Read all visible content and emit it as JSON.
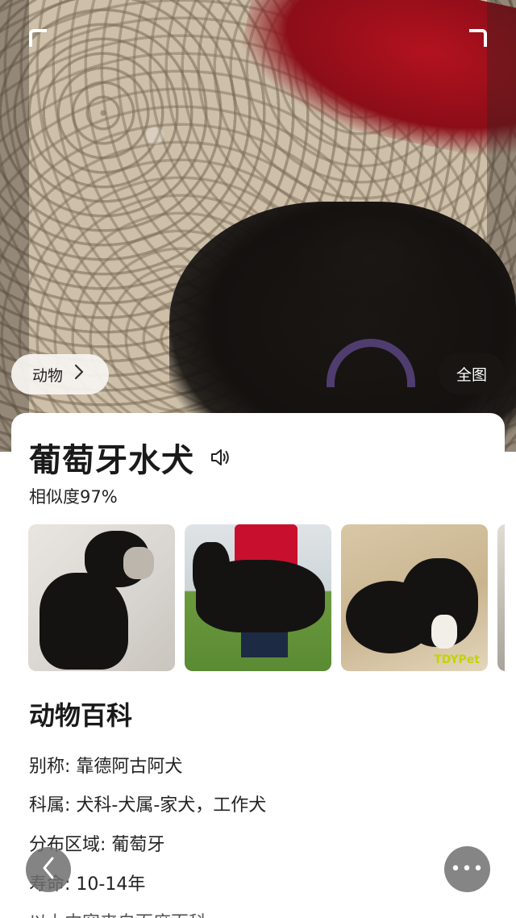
{
  "photo": {
    "category_label": "动物",
    "fullview_label": "全图"
  },
  "result": {
    "title": "葡萄牙水犬",
    "similarity": "相似度97%",
    "thumb_watermark": "TDYPet"
  },
  "encyclopedia": {
    "heading": "动物百科",
    "items": [
      {
        "label": "别称: ",
        "value": "靠德阿古阿犬"
      },
      {
        "label": "科属: ",
        "value": "犬科-犬属-家犬，工作犬"
      },
      {
        "label": "分布区域: ",
        "value": "葡萄牙"
      },
      {
        "label": "寿命: ",
        "value": "10-14年"
      }
    ],
    "source_note": "以上内容来自百度百科"
  },
  "controls": {
    "more_label": "•••"
  },
  "colors": {
    "overlay_dark": "#191614",
    "card_bg": "#ffffff",
    "text": "#1a1a1a"
  }
}
